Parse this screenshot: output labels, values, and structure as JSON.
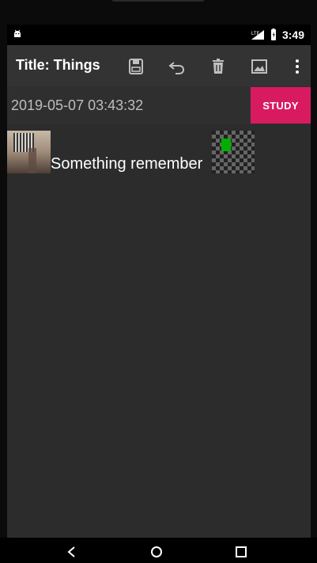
{
  "status_bar": {
    "time": "3:49",
    "network_type": "LTE"
  },
  "app_bar": {
    "title": "Title: Things",
    "actions": [
      {
        "name": "save-icon"
      },
      {
        "name": "undo-icon"
      },
      {
        "name": "delete-icon"
      },
      {
        "name": "image-icon"
      },
      {
        "name": "more-options-icon"
      }
    ]
  },
  "header": {
    "date": "2019-05-07 03:43:32",
    "study_label": "STUDY"
  },
  "item": {
    "text": "Something remember"
  },
  "colors": {
    "background": "#2c2c2c",
    "app_bar": "#333333",
    "study_button": "#d81b60",
    "indicator": "#00b000"
  }
}
